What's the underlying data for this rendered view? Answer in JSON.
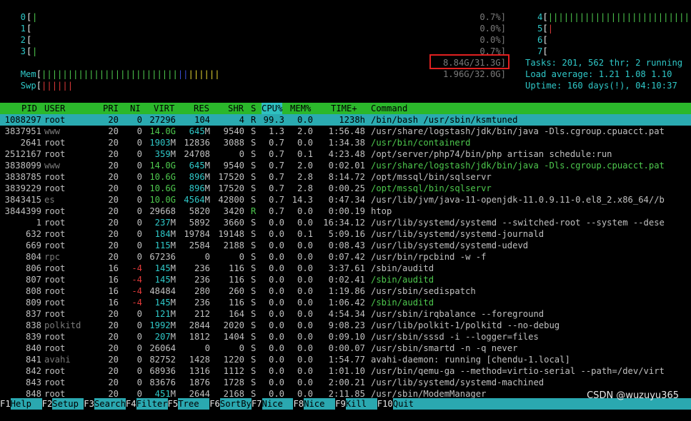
{
  "meters": {
    "cpus_left": [
      {
        "id": "0",
        "bar": "|",
        "pct": "0.7%]"
      },
      {
        "id": "1",
        "bar": "",
        "pct": "0.0%]"
      },
      {
        "id": "2",
        "bar": "",
        "pct": "0.0%]"
      },
      {
        "id": "3",
        "bar": "|",
        "pct": "0.7%]"
      }
    ],
    "cpus_right": [
      {
        "id": "4",
        "bar": "|||||||||||||||||||||||||||"
      },
      {
        "id": "5",
        "bar": "|"
      },
      {
        "id": "6",
        "bar": ""
      },
      {
        "id": "7",
        "bar": ""
      }
    ],
    "mem": {
      "label": "Mem",
      "bar_green": "||||||||||||||||||||||||||",
      "bar_blue": "||",
      "bar_yellow": "||||||",
      "value": "8.84G/31.3G]"
    },
    "swp": {
      "label": "Swp",
      "bar_red": "||||||",
      "value": "1.96G/32.0G]"
    }
  },
  "summary": {
    "tasks": "Tasks: 201, 562 thr; 2 running",
    "load": "Load average: 1.21 1.08 1.10",
    "uptime": "Uptime: 160 days(!), 04:10:37"
  },
  "columns": [
    "PID",
    "USER",
    "PRI",
    "NI",
    "VIRT",
    "RES",
    "SHR",
    "S",
    "CPU%",
    "MEM%",
    "TIME+",
    "Command"
  ],
  "processes": [
    {
      "pid": "1088297",
      "user": "root",
      "pri": "20",
      "ni": "0",
      "virt": "27296",
      "res": "104",
      "shr": "4",
      "s": "R",
      "cpu": "99.3",
      "mem": "0.0",
      "time": "1238h",
      "cmd": "/bin/bash /usr/sbin/ksmtuned",
      "selected": true
    },
    {
      "pid": "3837951",
      "user": "www",
      "pri": "20",
      "ni": "0",
      "virt": "14.0G",
      "res": "645M",
      "shr": "9540",
      "s": "S",
      "cpu": "1.3",
      "mem": "2.0",
      "time": "1:56.48",
      "cmd": "/usr/share/logstash/jdk/bin/java -Dls.cgroup.cpuacct.pat"
    },
    {
      "pid": "2641",
      "user": "root",
      "pri": "20",
      "ni": "0",
      "virt": "1903M",
      "res": "12836",
      "shr": "3088",
      "s": "S",
      "cpu": "0.7",
      "mem": "0.0",
      "time": "1:34.38",
      "cmd": "/usr/bin/containerd",
      "cmd_color": "green"
    },
    {
      "pid": "2512167",
      "user": "root",
      "pri": "20",
      "ni": "0",
      "virt": "359M",
      "res": "24708",
      "shr": "0",
      "s": "S",
      "cpu": "0.7",
      "mem": "0.1",
      "time": "4:23.48",
      "cmd": "/opt/server/php74/bin/php artisan schedule:run"
    },
    {
      "pid": "3838099",
      "user": "www",
      "pri": "20",
      "ni": "0",
      "virt": "14.0G",
      "res": "645M",
      "shr": "9540",
      "s": "S",
      "cpu": "0.7",
      "mem": "2.0",
      "time": "0:02.01",
      "cmd": "/usr/share/logstash/jdk/bin/java -Dls.cgroup.cpuacct.pat",
      "cmd_color": "green"
    },
    {
      "pid": "3838785",
      "user": "root",
      "pri": "20",
      "ni": "0",
      "virt": "10.6G",
      "res": "896M",
      "shr": "17520",
      "s": "S",
      "cpu": "0.7",
      "mem": "2.8",
      "time": "8:14.72",
      "cmd": "/opt/mssql/bin/sqlservr"
    },
    {
      "pid": "3839229",
      "user": "root",
      "pri": "20",
      "ni": "0",
      "virt": "10.6G",
      "res": "896M",
      "shr": "17520",
      "s": "S",
      "cpu": "0.7",
      "mem": "2.8",
      "time": "0:00.25",
      "cmd": "/opt/mssql/bin/sqlservr",
      "cmd_color": "green"
    },
    {
      "pid": "3843415",
      "user": "es",
      "pri": "20",
      "ni": "0",
      "virt": "10.0G",
      "res": "4564M",
      "shr": "42800",
      "s": "S",
      "cpu": "0.7",
      "mem": "14.3",
      "time": "0:47.34",
      "cmd": "/usr/lib/jvm/java-11-openjdk-11.0.9.11-0.el8_2.x86_64//b"
    },
    {
      "pid": "3844399",
      "user": "root",
      "pri": "20",
      "ni": "0",
      "virt": "29668",
      "res": "5820",
      "shr": "3420",
      "s": "R",
      "cpu": "0.7",
      "mem": "0.0",
      "time": "0:00.19",
      "cmd": "htop"
    },
    {
      "pid": "1",
      "user": "root",
      "pri": "20",
      "ni": "0",
      "virt": "237M",
      "res": "5892",
      "shr": "3660",
      "s": "S",
      "cpu": "0.0",
      "mem": "0.0",
      "time": "16:34.12",
      "cmd": "/usr/lib/systemd/systemd --switched-root --system --dese"
    },
    {
      "pid": "632",
      "user": "root",
      "pri": "20",
      "ni": "0",
      "virt": "184M",
      "res": "19784",
      "shr": "19148",
      "s": "S",
      "cpu": "0.0",
      "mem": "0.1",
      "time": "5:09.16",
      "cmd": "/usr/lib/systemd/systemd-journald"
    },
    {
      "pid": "669",
      "user": "root",
      "pri": "20",
      "ni": "0",
      "virt": "115M",
      "res": "2584",
      "shr": "2188",
      "s": "S",
      "cpu": "0.0",
      "mem": "0.0",
      "time": "0:08.43",
      "cmd": "/usr/lib/systemd/systemd-udevd"
    },
    {
      "pid": "804",
      "user": "rpc",
      "pri": "20",
      "ni": "0",
      "virt": "67236",
      "res": "0",
      "shr": "0",
      "s": "S",
      "cpu": "0.0",
      "mem": "0.0",
      "time": "0:07.42",
      "cmd": "/usr/bin/rpcbind -w -f"
    },
    {
      "pid": "806",
      "user": "root",
      "pri": "16",
      "ni": "-4",
      "virt": "145M",
      "res": "236",
      "shr": "116",
      "s": "S",
      "cpu": "0.0",
      "mem": "0.0",
      "time": "3:37.61",
      "cmd": "/sbin/auditd"
    },
    {
      "pid": "807",
      "user": "root",
      "pri": "16",
      "ni": "-4",
      "virt": "145M",
      "res": "236",
      "shr": "116",
      "s": "S",
      "cpu": "0.0",
      "mem": "0.0",
      "time": "0:02.41",
      "cmd": "/sbin/auditd",
      "cmd_color": "green"
    },
    {
      "pid": "808",
      "user": "root",
      "pri": "16",
      "ni": "-4",
      "virt": "48484",
      "res": "280",
      "shr": "260",
      "s": "S",
      "cpu": "0.0",
      "mem": "0.0",
      "time": "1:19.86",
      "cmd": "/usr/sbin/sedispatch"
    },
    {
      "pid": "809",
      "user": "root",
      "pri": "16",
      "ni": "-4",
      "virt": "145M",
      "res": "236",
      "shr": "116",
      "s": "S",
      "cpu": "0.0",
      "mem": "0.0",
      "time": "1:06.42",
      "cmd": "/sbin/auditd",
      "cmd_color": "green"
    },
    {
      "pid": "837",
      "user": "root",
      "pri": "20",
      "ni": "0",
      "virt": "121M",
      "res": "212",
      "shr": "164",
      "s": "S",
      "cpu": "0.0",
      "mem": "0.0",
      "time": "4:54.34",
      "cmd": "/usr/sbin/irqbalance --foreground"
    },
    {
      "pid": "838",
      "user": "polkitd",
      "pri": "20",
      "ni": "0",
      "virt": "1992M",
      "res": "2844",
      "shr": "2020",
      "s": "S",
      "cpu": "0.0",
      "mem": "0.0",
      "time": "9:08.23",
      "cmd": "/usr/lib/polkit-1/polkitd --no-debug"
    },
    {
      "pid": "839",
      "user": "root",
      "pri": "20",
      "ni": "0",
      "virt": "207M",
      "res": "1812",
      "shr": "1404",
      "s": "S",
      "cpu": "0.0",
      "mem": "0.0",
      "time": "0:09.10",
      "cmd": "/usr/sbin/sssd -i --logger=files"
    },
    {
      "pid": "840",
      "user": "root",
      "pri": "20",
      "ni": "0",
      "virt": "26064",
      "res": "0",
      "shr": "0",
      "s": "S",
      "cpu": "0.0",
      "mem": "0.0",
      "time": "0:00.07",
      "cmd": "/usr/sbin/smartd -n -q never"
    },
    {
      "pid": "841",
      "user": "avahi",
      "pri": "20",
      "ni": "0",
      "virt": "82752",
      "res": "1428",
      "shr": "1220",
      "s": "S",
      "cpu": "0.0",
      "mem": "0.0",
      "time": "1:54.77",
      "cmd": "avahi-daemon: running [chendu-1.local]"
    },
    {
      "pid": "842",
      "user": "root",
      "pri": "20",
      "ni": "0",
      "virt": "68936",
      "res": "1316",
      "shr": "1112",
      "s": "S",
      "cpu": "0.0",
      "mem": "0.0",
      "time": "1:01.10",
      "cmd": "/usr/bin/qemu-ga --method=virtio-serial --path=/dev/virt"
    },
    {
      "pid": "843",
      "user": "root",
      "pri": "20",
      "ni": "0",
      "virt": "83676",
      "res": "1876",
      "shr": "1728",
      "s": "S",
      "cpu": "0.0",
      "mem": "0.0",
      "time": "2:00.21",
      "cmd": "/usr/lib/systemd/systemd-machined"
    },
    {
      "pid": "848",
      "user": "root",
      "pri": "20",
      "ni": "0",
      "virt": "451M",
      "res": "2644",
      "shr": "2168",
      "s": "S",
      "cpu": "0.0",
      "mem": "0.0",
      "time": "2:11.85",
      "cmd": "/usr/sbin/ModemManager"
    }
  ],
  "fkeys": [
    {
      "key": "F1",
      "label": "Help  "
    },
    {
      "key": "F2",
      "label": "Setup "
    },
    {
      "key": "F3",
      "label": "Search"
    },
    {
      "key": "F4",
      "label": "Filter"
    },
    {
      "key": "F5",
      "label": "Tree  "
    },
    {
      "key": "F6",
      "label": "SortBy"
    },
    {
      "key": "F7",
      "label": "Nice -"
    },
    {
      "key": "F8",
      "label": "Nice +"
    },
    {
      "key": "F9",
      "label": "Kill  "
    },
    {
      "key": "F10",
      "label": "Quit"
    }
  ],
  "watermark": "CSDN @wuzuyu365",
  "colors": {
    "header_bg": "#2bb82b",
    "selected_bg": "#2aaab0",
    "fkey_bg": "#2aa8b0",
    "highlight": "#e02020"
  }
}
